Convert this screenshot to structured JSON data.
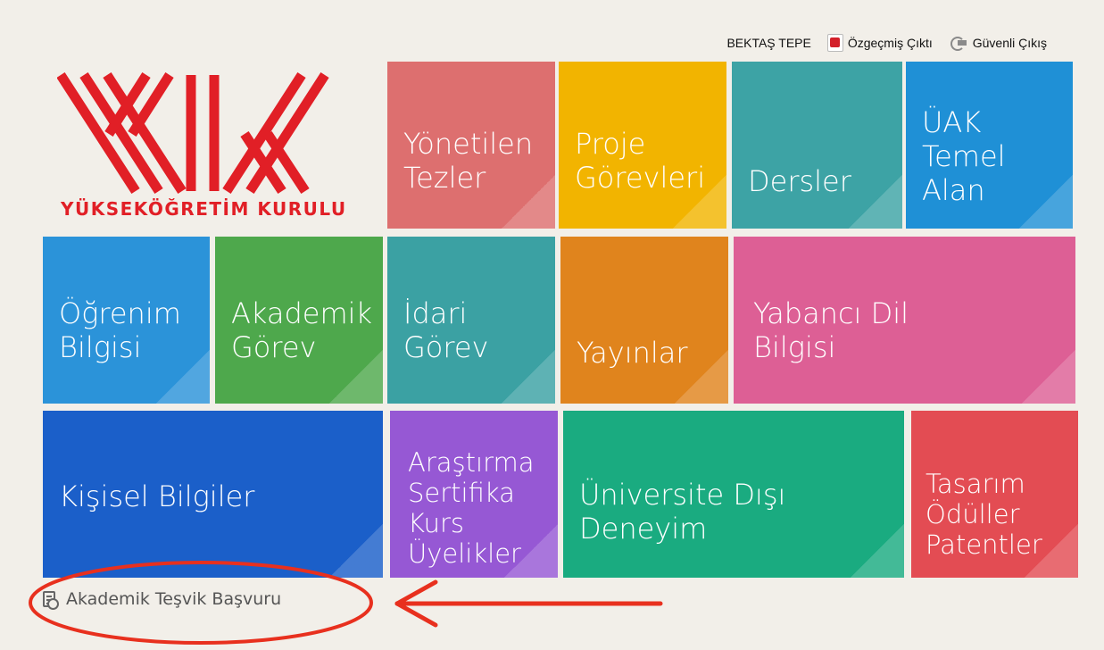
{
  "header": {
    "user_name": "BEKTAŞ TEPE",
    "cv_label": "Özgeçmiş Çıktı",
    "logout_label": "Güvenli Çıkış"
  },
  "logo": {
    "text": "YÜKSEKÖĞRETİM KURULU",
    "color": "#e11f26"
  },
  "tiles": [
    {
      "line1": "Yönetilen",
      "line2": "Tezler",
      "color": "#dd6f6f"
    },
    {
      "line1": "Proje",
      "line2": "Görevleri",
      "color": "#f2b400"
    },
    {
      "line1": "Dersler",
      "color": "#3da3a5"
    },
    {
      "line1": "ÜAK",
      "line2": "Temel",
      "line3": "Alan",
      "color": "#1f90d6"
    },
    {
      "line1": "Öğrenim",
      "line2": "Bilgisi",
      "color": "#2b93d9"
    },
    {
      "line1": "Akademik",
      "line2": "Görev",
      "color": "#4ea84c"
    },
    {
      "line1": "İdari",
      "line2": "Görev",
      "color": "#3ba1a3"
    },
    {
      "line1": "Yayınlar",
      "color": "#e0841d"
    },
    {
      "line1": "Yabancı Dil",
      "line2": "Bilgisi",
      "color": "#dd5f95"
    },
    {
      "line1": "Kişisel Bilgiler",
      "color": "#1b5fc9"
    },
    {
      "line1": "Araştırma",
      "line2": "Sertifika",
      "line3": "Kurs",
      "line4": "Üyelikler",
      "color": "#9658d4"
    },
    {
      "line1": "Üniversite Dışı",
      "line2": "Deneyim",
      "color": "#1aab80"
    },
    {
      "line1": "Tasarım",
      "line2": "Ödüller",
      "line3": "Patentler",
      "color": "#e34c53"
    }
  ],
  "footer": {
    "incentive_label": "Akademik Teşvik Başvuru"
  },
  "annotation": {
    "color": "#e8301e"
  }
}
